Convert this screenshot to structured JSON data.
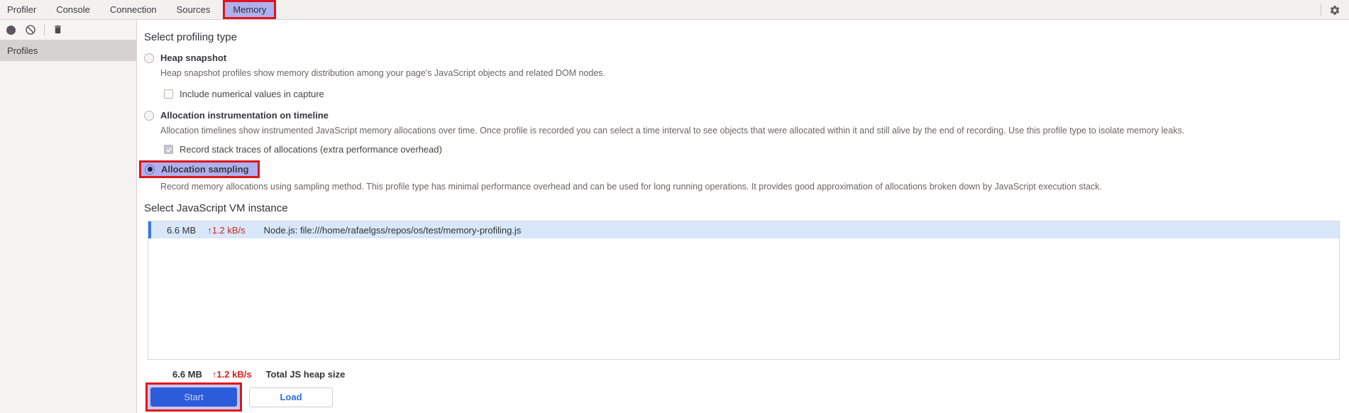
{
  "tabs": {
    "items": [
      "Profiler",
      "Console",
      "Connection",
      "Sources",
      "Memory"
    ],
    "active": "Memory"
  },
  "toolbar": {
    "icons": [
      "record-icon",
      "clear-icon",
      "trash-icon"
    ],
    "settings_icon": "gear-icon"
  },
  "sidebar": {
    "header": "Profiles"
  },
  "profiling": {
    "title": "Select profiling type",
    "options": [
      {
        "label": "Heap snapshot",
        "selected": false,
        "description": "Heap snapshot profiles show memory distribution among your page's JavaScript objects and related DOM nodes.",
        "child_checkbox": {
          "label": "Include numerical values in capture",
          "checked": false
        }
      },
      {
        "label": "Allocation instrumentation on timeline",
        "selected": false,
        "description": "Allocation timelines show instrumented JavaScript memory allocations over time. Once profile is recorded you can select a time interval to see objects that were allocated within it and still alive by the end of recording. Use this profile type to isolate memory leaks.",
        "child_checkbox": {
          "label": "Record stack traces of allocations (extra performance overhead)",
          "checked": true
        }
      },
      {
        "label": "Allocation sampling",
        "selected": true,
        "highlighted": true,
        "description": "Record memory allocations using sampling method. This profile type has minimal performance overhead and can be used for long running operations. It provides good approximation of allocations broken down by JavaScript execution stack."
      }
    ]
  },
  "vm": {
    "title": "Select JavaScript VM instance",
    "instance": {
      "size": "6.6 MB",
      "rate": "↑1.2 kB/s",
      "name": "Node.js: file:///home/rafaelgss/repos/os/test/memory-profiling.js",
      "selected": true
    },
    "total": {
      "size": "6.6 MB",
      "rate": "↑1.2 kB/s",
      "label": "Total JS heap size"
    }
  },
  "actions": {
    "start": "Start",
    "load": "Load"
  },
  "colors": {
    "annotation-red": "#e0151b",
    "annotation-lavender": "#aeb1ee",
    "selection-row-bg": "#d8e7fa",
    "selection-row-accent": "#3c78dc",
    "rate-red": "#cf2420",
    "start-blue": "#2c5cd9",
    "link-blue": "#2b6de0"
  }
}
